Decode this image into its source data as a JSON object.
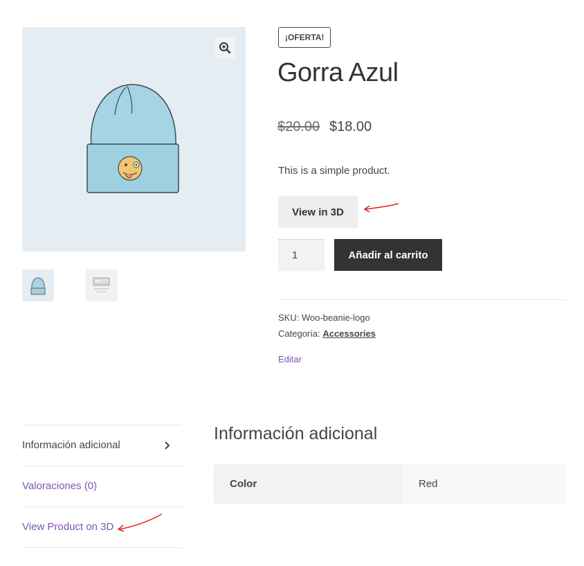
{
  "gallery": {
    "zoom_icon": "zoom-in-icon",
    "thumbnails": [
      "beanie-thumbnail",
      "woo-logo-thumbnail"
    ],
    "thumbnail_2_text": "WOO"
  },
  "product": {
    "badge": "¡OFERTA!",
    "title": "Gorra Azul",
    "old_price": "$20.00",
    "price": "$18.00",
    "short_description": "This is a simple product.",
    "view3d_label": "View in 3D",
    "quantity": "1",
    "add_to_cart_label": "Añadir al carrito"
  },
  "meta": {
    "sku_label": "SKU:",
    "sku_value": "Woo-beanie-logo",
    "category_label": "Categoría:",
    "category_value": "Accessories",
    "edit_label": "Editar"
  },
  "tabs": [
    {
      "label": "Información adicional",
      "active": true
    },
    {
      "label": "Valoraciones (0)",
      "active": false
    },
    {
      "label": "View Product on 3D",
      "active": false
    }
  ],
  "panel": {
    "title": "Información adicional",
    "attributes": [
      {
        "label": "Color",
        "value": "Red"
      }
    ]
  },
  "colors": {
    "accent_link": "#7f54b3",
    "button_dark": "#333333",
    "annotation_arrow": "#e02020"
  }
}
